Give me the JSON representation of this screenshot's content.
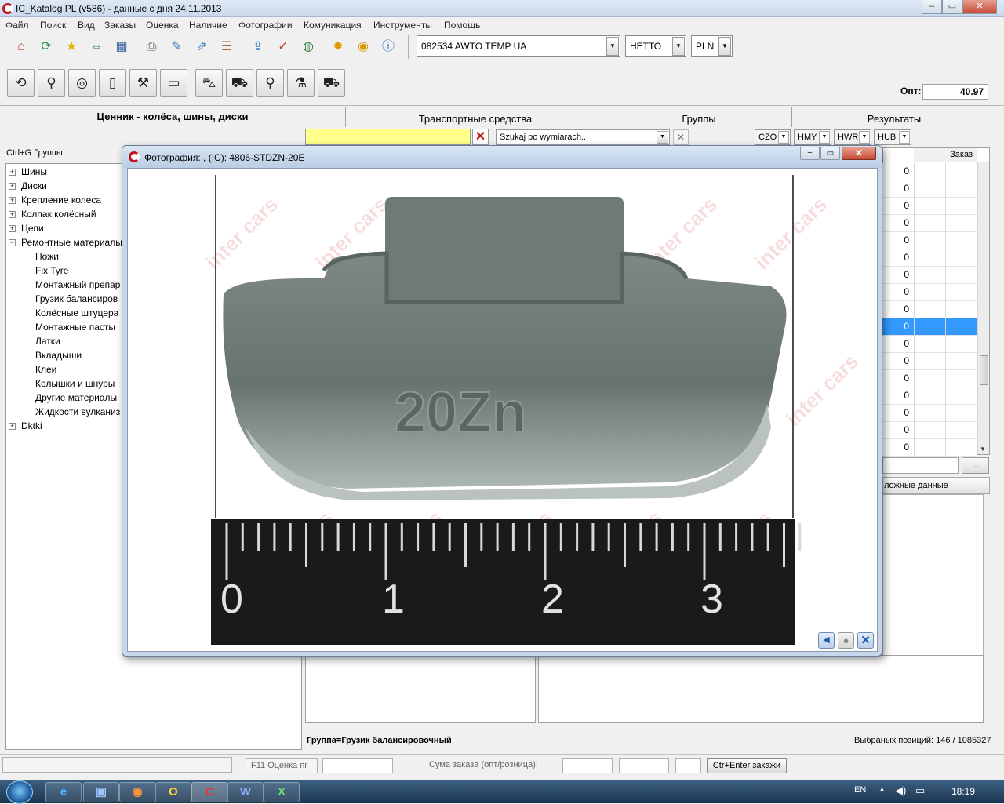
{
  "app": {
    "title": "IC_Katalog PL (v586) - данные с дня 24.11.2013",
    "controls": {
      "minimize": "‒",
      "maximize": "▭",
      "close": "✕"
    }
  },
  "menu": [
    "Файл",
    "Поиск",
    "Вид",
    "Заказы",
    "Оценка",
    "Наличие",
    "Фотографии",
    "Комуникация",
    "Инструменты",
    "Помощь"
  ],
  "toolbar": {
    "client_combo": "082534  AWTO TEMP UA",
    "price_combo": "НЕТТО",
    "currency_combo": "PLN",
    "opt_label": "Опт:",
    "opt_value": "40.97"
  },
  "sections": {
    "pricelist": "Ценник - колёса, шины, диски",
    "vehicles": "Транспортные средства",
    "groups": "Группы",
    "results": "Результаты"
  },
  "filters": {
    "dimension_search": "Szukaj po wymiarach...",
    "chips": [
      "CZO",
      "HMY",
      "HWR",
      "HUB"
    ],
    "browse_btn": "..."
  },
  "tree": {
    "header": "Ctrl+G Группы",
    "top": [
      "Шины",
      "Диски",
      "Крепление колеса",
      "Колпак колёсный",
      "Цепи",
      "Ремонтные материалы"
    ],
    "children": [
      "Ножи",
      "Fix Tyre",
      "Монтажный препар",
      "Грузик балансиров",
      "Колёсные штуцера",
      "Монтажные пасты",
      "Латки",
      "Вкладыши",
      "Клеи",
      "Колышки и шнуры",
      "Другие материалы",
      "Жидкости вулканиз"
    ],
    "last": "Dktki"
  },
  "results": {
    "col_order": "Заказ",
    "values": [
      "0",
      "0",
      "0",
      "0",
      "0",
      "0",
      "0",
      "0",
      "0",
      "0",
      "0",
      "0",
      "0",
      "0",
      "0",
      "0",
      "0"
    ],
    "selected_index": 9,
    "tab_extra": "ложные данные"
  },
  "dialog": {
    "title": "Фотография: , (IC): 4806-STDZN-20E",
    "watermark": "inter cars",
    "weight_mark": "20Zn",
    "ruler": [
      "0",
      "1",
      "2",
      "3"
    ]
  },
  "status": {
    "group": "Группа=Грузик балансировочный",
    "count": "Выбраных позиций: 146 / 1085327",
    "f11": "F11 Оценка пг",
    "sum_label": "Сума заказа (опт/розница):",
    "order_btn": "Ctr+Enter закажи"
  },
  "taskbar": {
    "lang": "EN",
    "time": "18:19"
  }
}
